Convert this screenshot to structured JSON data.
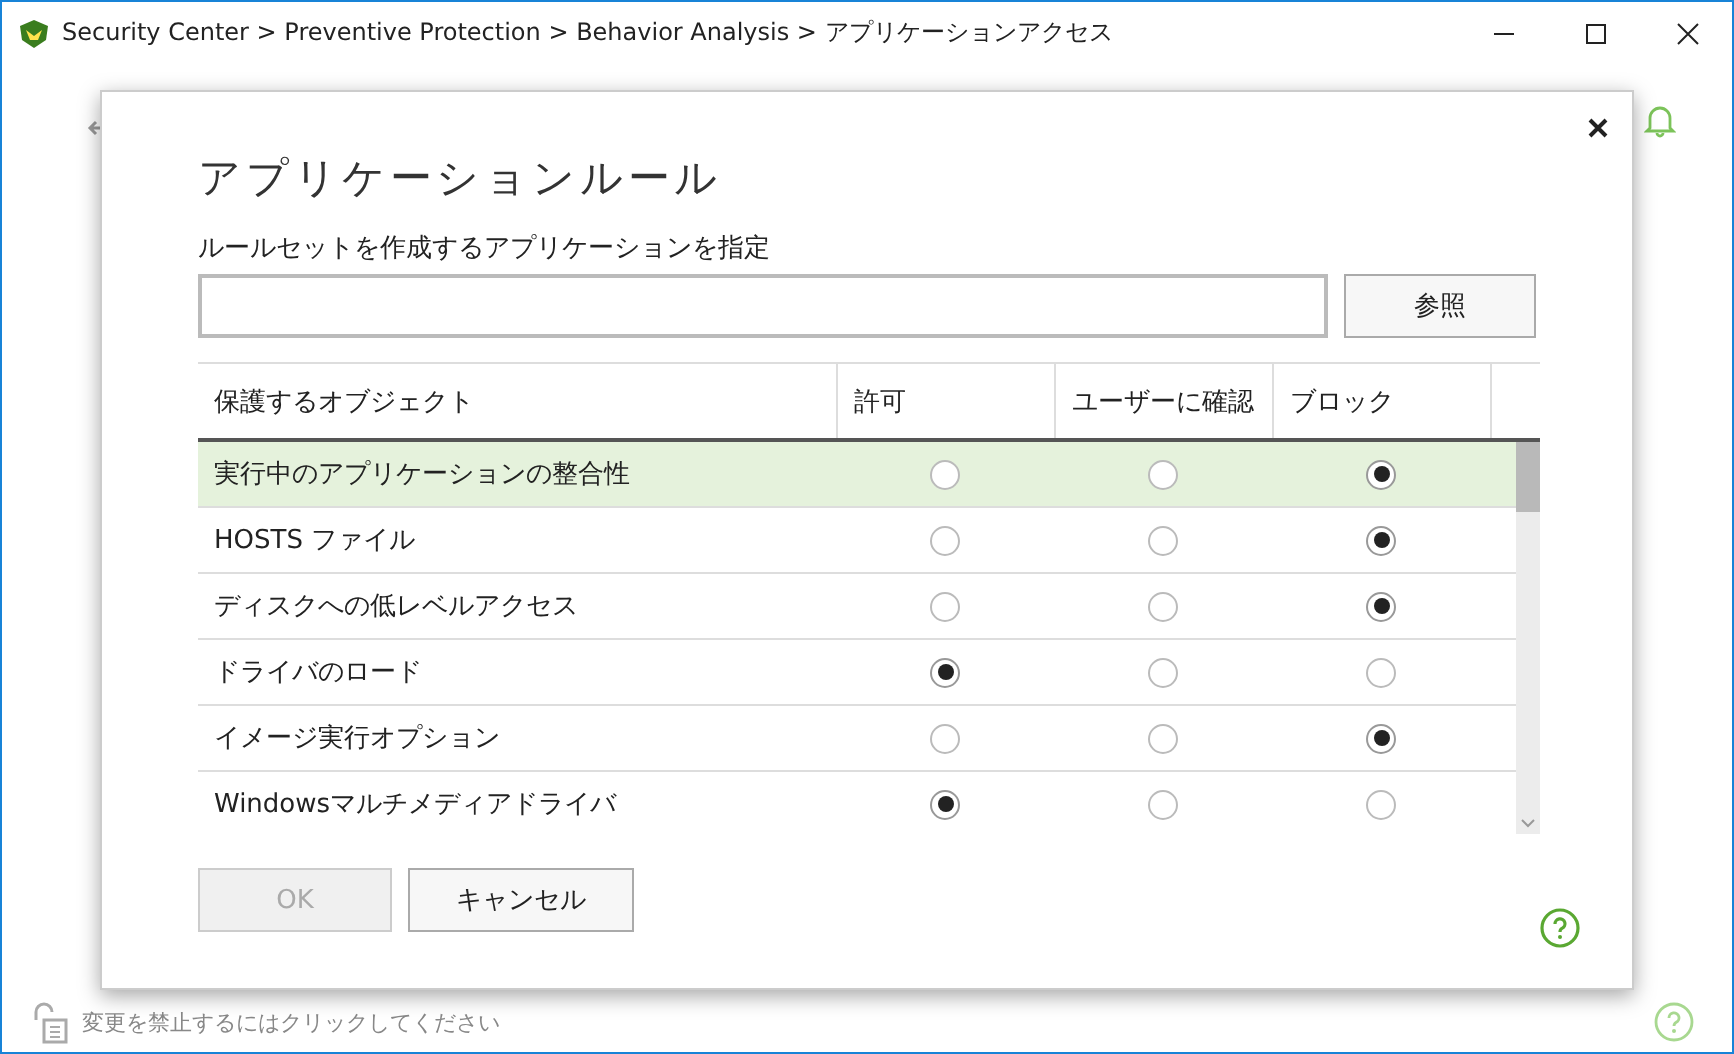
{
  "window": {
    "title": "Security Center > Preventive Protection > Behavior Analysis > アプリケーションアクセス"
  },
  "dialog": {
    "title": "アプリケーションルール",
    "field_label": "ルールセットを作成するアプリケーションを指定",
    "browse_button": "参照",
    "table": {
      "columns": [
        "保護するオブジェクト",
        "許可",
        "ユーザーに確認",
        "ブロック"
      ],
      "rows": [
        {
          "name": "実行中のアプリケーションの整合性",
          "selected": true,
          "options": [
            {
              "selected": false
            },
            {
              "selected": false
            },
            {
              "selected": true
            }
          ]
        },
        {
          "name": "HOSTS ファイル",
          "selected": false,
          "options": [
            {
              "selected": false
            },
            {
              "selected": false
            },
            {
              "selected": true
            }
          ]
        },
        {
          "name": "ディスクへの低レベルアクセス",
          "selected": false,
          "options": [
            {
              "selected": false
            },
            {
              "selected": false
            },
            {
              "selected": true
            }
          ]
        },
        {
          "name": "ドライバのロード",
          "selected": false,
          "options": [
            {
              "selected": true
            },
            {
              "selected": false
            },
            {
              "selected": false
            }
          ]
        },
        {
          "name": "イメージ実行オプション",
          "selected": false,
          "options": [
            {
              "selected": false
            },
            {
              "selected": false
            },
            {
              "selected": true
            }
          ]
        },
        {
          "name": "Windowsマルチメディアドライバ",
          "selected": false,
          "options": [
            {
              "selected": true
            },
            {
              "selected": false
            },
            {
              "selected": false
            }
          ]
        }
      ]
    },
    "buttons": [
      {
        "label": "OK",
        "disabled": true
      },
      {
        "label": "キャンセル",
        "disabled": false
      }
    ]
  },
  "status_bar": {
    "text": "変更を禁止するにはクリックしてください"
  }
}
